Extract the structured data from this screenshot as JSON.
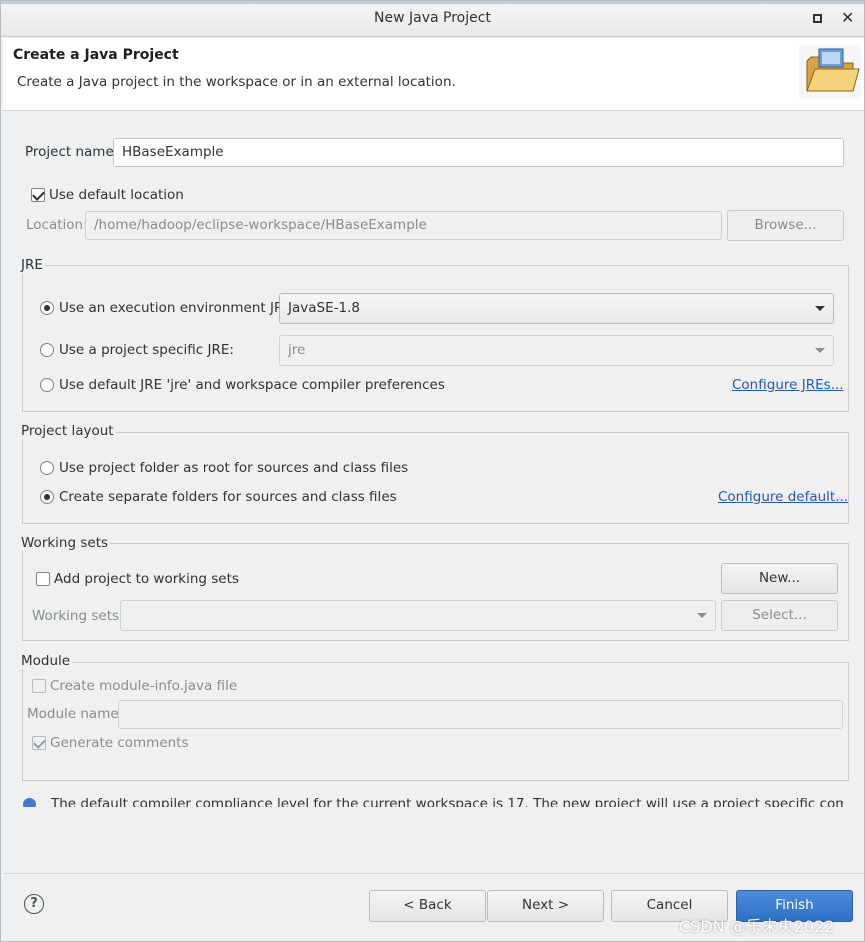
{
  "window": {
    "title": "New Java Project"
  },
  "header": {
    "title": "Create a Java Project",
    "description": "Create a Java project in the workspace or in an external location."
  },
  "project": {
    "name_label": "Project name:",
    "name_value": "HBaseExample",
    "use_default_location_label": "Use default location",
    "use_default_location_checked": true,
    "location_label": "Location:",
    "location_value": "/home/hadoop/eclipse-workspace/HBaseExample",
    "browse_label": "Browse..."
  },
  "jre": {
    "group_title": "JRE",
    "options": [
      {
        "label": "Use an execution environment JRE:",
        "selected": true,
        "combo_value": "JavaSE-1.8"
      },
      {
        "label": "Use a project specific JRE:",
        "selected": false,
        "combo_value": "jre"
      },
      {
        "label": "Use default JRE 'jre' and workspace compiler preferences",
        "selected": false
      }
    ],
    "configure_link": "Configure JREs..."
  },
  "layout": {
    "group_title": "Project layout",
    "options": [
      {
        "label": "Use project folder as root for sources and class files",
        "selected": false
      },
      {
        "label": "Create separate folders for sources and class files",
        "selected": true
      }
    ],
    "configure_link": "Configure default..."
  },
  "working_sets": {
    "group_title": "Working sets",
    "add_label": "Add project to working sets",
    "add_checked": false,
    "new_label": "New...",
    "sets_label": "Working sets:",
    "sets_value": "",
    "select_label": "Select..."
  },
  "module": {
    "group_title": "Module",
    "create_label": "Create module-info.java file",
    "name_label": "Module name:",
    "name_value": "",
    "generate_label": "Generate comments"
  },
  "info": {
    "text": "The default compiler compliance level for the current workspace is 17. The new project will use a project specific compiler"
  },
  "footer": {
    "help_symbol": "?",
    "back_label": "< Back",
    "next_label": "Next >",
    "cancel_label": "Cancel",
    "finish_label": "Finish"
  },
  "watermark": "CSDN @乐未央2022"
}
